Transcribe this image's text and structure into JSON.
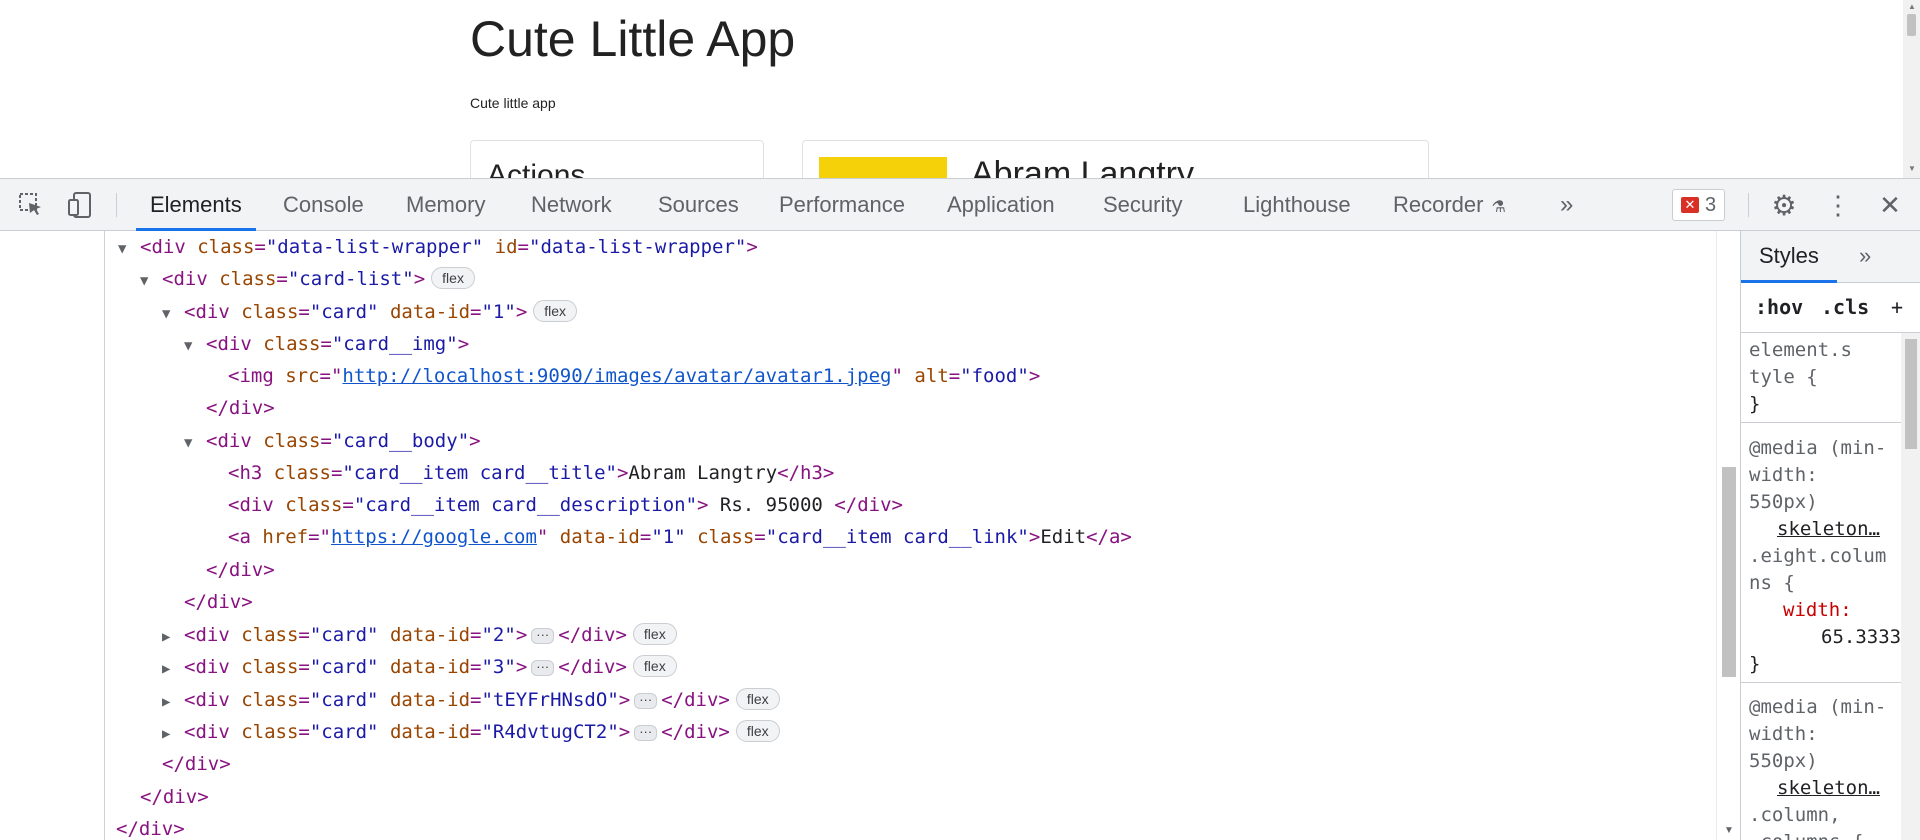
{
  "page": {
    "title": "Cute Little App",
    "subtitle": "Cute little app",
    "actions_heading": "Actions",
    "person_name": "Abram Langtry"
  },
  "devtools": {
    "tabs": [
      "Elements",
      "Console",
      "Memory",
      "Network",
      "Sources",
      "Performance",
      "Application",
      "Security",
      "Lighthouse",
      "Recorder"
    ],
    "active_tab": "Elements",
    "error_count": "3",
    "more_tabs_glyph": "»",
    "styles_tab": "Styles",
    "styles_more_glyph": "»",
    "filter_hov": ":hov",
    "filter_cls": ".cls",
    "filter_plus": "+"
  },
  "tree": {
    "l1_tag": "<div ",
    "l1_a1": "class",
    "l1_v1": "\"data-list-wrapper\"",
    "l1_a2": "id",
    "l1_v2": "\"data-list-wrapper\"",
    "l1_end": ">",
    "l2_tag": "<div ",
    "l2_a1": "class",
    "l2_v1": "\"card-list\"",
    "l2_end": ">",
    "l3_a2": "data-id",
    "l3_v2": "\"1\"",
    "card_class": "\"card\"",
    "l4_v1": "\"card__img\"",
    "l5_a1": "src",
    "l5_link": "http://localhost:9090/images/avatar/avatar1.jpeg",
    "l5_a2": "alt",
    "l5_v2": "\"food\"",
    "close_div": "</div>",
    "l7_v1": "\"card__body\"",
    "l8_v1": "\"card__item card__title\"",
    "l8_text": "Abram Langtry",
    "l9_v1": "\"card__item card__description\"",
    "l9_text": " Rs. 95000 ",
    "l10_a1": "href",
    "l10_link": "https://google.com",
    "l10_v2": "\"1\"",
    "l10_v3": "\"card__item card__link\"",
    "l10_text": "Edit",
    "collapsed_ids": [
      "\"2\"",
      "\"3\"",
      "\"tEYFrHNsdO\"",
      "\"R4dvtugCT2\""
    ],
    "flex_label": "flex",
    "ellipsis": "···"
  },
  "styles": {
    "r1_sel1": "element.s",
    "r1_sel2": "tyle {",
    "r1_close": "}",
    "r2_at": "@media (min-",
    "r2_at2": "width:",
    "r2_at3": "550px)",
    "r2_src": "skeleton…",
    "r2_sel": ".eight.colum",
    "r2_sel2": "ns {",
    "r2_prop": "width:",
    "r2_val": "65.3333",
    "r2_close": "}",
    "r3_at": "@media (min-",
    "r3_at2": "width:",
    "r3_at3": "550px)",
    "r3_src": "skeleton…",
    "r3_sel": ".column,",
    "r3_sel2": ".columns {"
  }
}
